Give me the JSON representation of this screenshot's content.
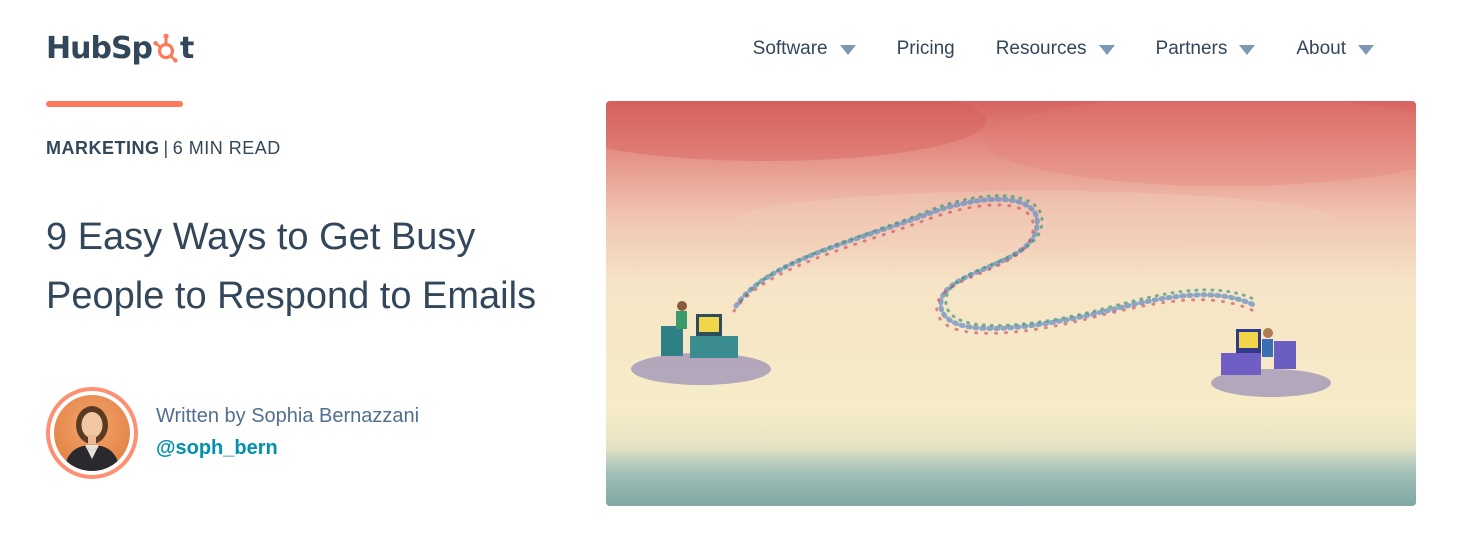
{
  "header": {
    "logo": {
      "prefix": "HubSp",
      "suffix": "t"
    },
    "nav": [
      {
        "label": "Software",
        "has_dropdown": true
      },
      {
        "label": "Pricing",
        "has_dropdown": false
      },
      {
        "label": "Resources",
        "has_dropdown": true
      },
      {
        "label": "Partners",
        "has_dropdown": true
      },
      {
        "label": "About",
        "has_dropdown": true
      }
    ]
  },
  "article": {
    "topic": "MARKETING",
    "separator": "|",
    "read_time": "6 MIN READ",
    "title": "9 Easy Ways to Get Busy People to Respond to Emails",
    "author": {
      "written_by": "Written by Sophia Bernazzani",
      "handle": "@soph_bern"
    }
  },
  "colors": {
    "accent": "#ff7a59",
    "text": "#33475b",
    "link": "#0091ae",
    "caret": "#7c98b6"
  },
  "icons": {
    "logo_mark": "sprocket-icon",
    "dropdown": "caret-down-icon"
  }
}
